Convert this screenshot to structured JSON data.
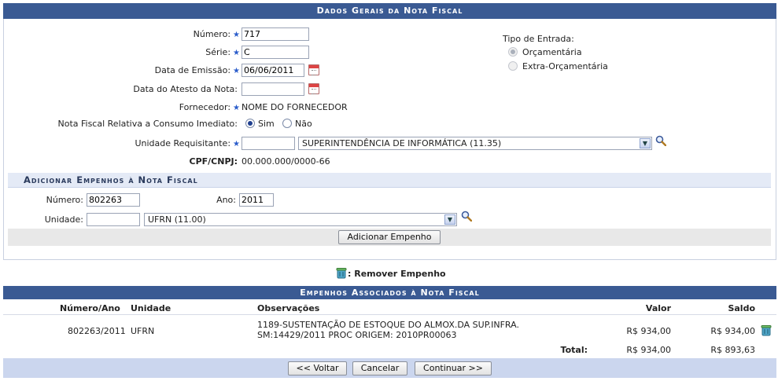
{
  "dados_gerais": {
    "title": "Dados Gerais da Nota Fiscal",
    "numero_label": "Número:",
    "numero_value": "717",
    "serie_label": "Série:",
    "serie_value": "C",
    "data_emissao_label": "Data de Emissão:",
    "data_emissao_value": "06/06/2011",
    "data_atesto_label": "Data do Atesto da Nota:",
    "data_atesto_value": "",
    "fornecedor_label": "Fornecedor:",
    "fornecedor_value": "NOME DO FORNECEDOR",
    "consumo_label": "Nota Fiscal Relativa a Consumo Imediato:",
    "consumo_sim": "Sim",
    "consumo_nao": "Não",
    "consumo_selected": "Sim",
    "unidade_label": "Unidade Requisitante:",
    "unidade_code_value": "",
    "unidade_select_value": "SUPERINTENDÊNCIA DE INFORMÁTICA (11.35)",
    "cpf_label": "CPF/CNPJ:",
    "cpf_value": "00.000.000/0000-66",
    "tipo_entrada_label": "Tipo de Entrada:",
    "tipo_orcamentaria": "Orçamentária",
    "tipo_extra": "Extra-Orçamentária",
    "tipo_selected": "Orçamentária"
  },
  "adicionar_empenhos": {
    "title": "Adicionar Empenhos à Nota Fiscal",
    "numero_label": "Número:",
    "numero_value": "802263",
    "ano_label": "Ano:",
    "ano_value": "2011",
    "unidade_label": "Unidade:",
    "unidade_code_value": "",
    "unidade_select_value": "UFRN (11.00)",
    "add_button": "Adicionar Empenho"
  },
  "legend": {
    "remove_label": ": Remover Empenho"
  },
  "empenhos_associados": {
    "title": "Empenhos Associados à Nota Fiscal",
    "headers": {
      "numero_ano": "Número/Ano",
      "unidade": "Unidade",
      "observacoes": "Observações",
      "valor": "Valor",
      "saldo": "Saldo"
    },
    "rows": [
      {
        "numero_ano": "802263/2011",
        "unidade": "UFRN",
        "observacoes_line1": "1189-SUSTENTAÇÃO DE ESTOQUE DO ALMOX.DA SUP.INFRA.",
        "observacoes_line2": "SM:14429/2011 PROC ORIGEM: 2010PR00063",
        "valor": "R$ 934,00",
        "saldo": "R$ 934,00"
      }
    ],
    "total_label": "Total:",
    "total_valor": "R$ 934,00",
    "total_saldo": "R$ 893,63"
  },
  "footer_buttons": {
    "voltar": "<< Voltar",
    "cancelar": "Cancelar",
    "continuar": "Continuar >>"
  },
  "colors": {
    "caption_bg": "#3a5a93",
    "subcaption_bg": "#e4eaf6",
    "footer_bg": "#cbd6ee",
    "star": "#2b5dcb"
  }
}
